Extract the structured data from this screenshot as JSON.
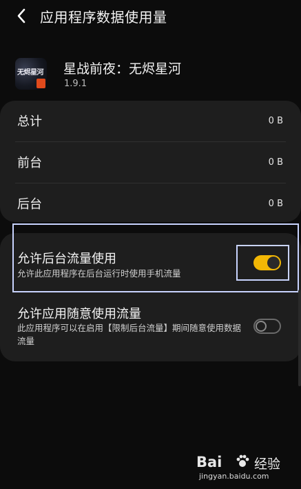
{
  "header": {
    "title": "应用程序数据使用量",
    "back_icon": "chevron-left-icon"
  },
  "app": {
    "name": "星战前夜：无烬星河",
    "version": "1.9.1",
    "icon_text": "无烬星河",
    "icon_name": "eve-echoes-app-icon"
  },
  "usage": [
    {
      "label": "总计",
      "value": "0 B"
    },
    {
      "label": "前台",
      "value": "0 B"
    },
    {
      "label": "后台",
      "value": "0 B"
    }
  ],
  "options": [
    {
      "title": "允许后台流量使用",
      "desc": "允许此应用程序在后台运行时使用手机流量",
      "enabled": true
    },
    {
      "title": "允许应用随意使用流量",
      "desc": "此应用程序可以在启用【限制后台流量】期间随意使用数据流量",
      "enabled": false
    }
  ],
  "colors": {
    "accent": "#f2b705",
    "highlight": "#c9d4ff",
    "card": "#1e1e1e",
    "background": "#0c0c0c"
  },
  "watermark": {
    "brand": "Bai",
    "brand2": "经验",
    "url": "jingyan.baidu.com"
  }
}
